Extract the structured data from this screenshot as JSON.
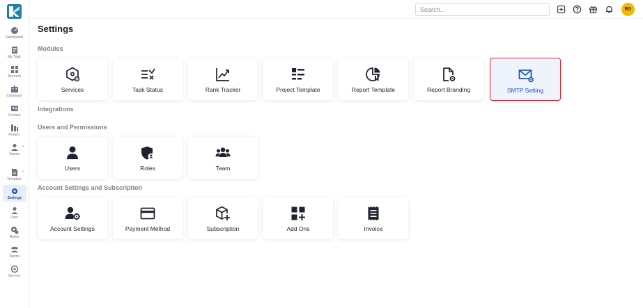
{
  "sidebar": {
    "items": [
      {
        "label": "Dashboard",
        "icon": "dashboard-icon"
      },
      {
        "label": "My Task",
        "icon": "task-icon"
      },
      {
        "label": "Account",
        "icon": "account-icon"
      },
      {
        "label": "Company",
        "icon": "company-icon"
      },
      {
        "label": "Contact",
        "icon": "contact-icon"
      },
      {
        "label": "Project",
        "icon": "project-icon"
      },
      {
        "label": "Teams",
        "icon": "teams-icon"
      },
      {
        "label": "Template",
        "icon": "template-icon"
      },
      {
        "label": "Settings",
        "icon": "settings-icon"
      },
      {
        "label": "User",
        "icon": "user-icon"
      },
      {
        "label": "Roles",
        "icon": "roles-icon"
      },
      {
        "label": "Teams",
        "icon": "teams-group-icon"
      },
      {
        "label": "Service",
        "icon": "service-icon"
      }
    ],
    "active": "Settings"
  },
  "topbar": {
    "search_placeholder": "Search...",
    "avatar_initials": "RS",
    "avatar_color": "#f5b800"
  },
  "page": {
    "title": "Settings"
  },
  "sections": {
    "modules": {
      "title": "Modules",
      "cards": [
        {
          "label": "Services",
          "icon": "services-icon"
        },
        {
          "label": "Task Status",
          "icon": "task-status-icon"
        },
        {
          "label": "Rank Tracker",
          "icon": "rank-tracker-icon"
        },
        {
          "label": "Project Template",
          "icon": "project-template-icon"
        },
        {
          "label": "Report Template",
          "icon": "report-template-icon"
        },
        {
          "label": "Report Branding",
          "icon": "report-branding-icon"
        },
        {
          "label": "SMTP Setting",
          "icon": "smtp-mail-icon"
        }
      ]
    },
    "integrations": {
      "title": "Integrations"
    },
    "users": {
      "title": "Users and Permissions",
      "cards": [
        {
          "label": "Users",
          "icon": "user-icon"
        },
        {
          "label": "Roles",
          "icon": "role-shield-icon"
        },
        {
          "label": "Team",
          "icon": "team-icon"
        }
      ]
    },
    "account": {
      "title": "Account Settings and Subscription",
      "cards": [
        {
          "label": "Account Settings",
          "icon": "account-settings-icon"
        },
        {
          "label": "Payment Method",
          "icon": "credit-card-icon"
        },
        {
          "label": "Subscription",
          "icon": "subscription-box-icon"
        },
        {
          "label": "Add Ons",
          "icon": "add-ons-icon"
        },
        {
          "label": "Invoice",
          "icon": "invoice-icon"
        }
      ]
    }
  },
  "colors": {
    "accent": "#1f4fb8",
    "selected_border": "#e0202a",
    "section_title": "#7c828e"
  }
}
